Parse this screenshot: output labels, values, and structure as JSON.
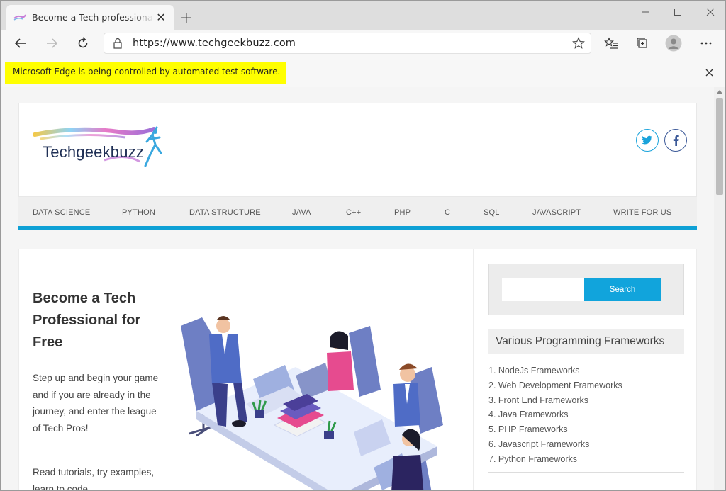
{
  "browser": {
    "tab_title": "Become a Tech professional for free",
    "url": "https://www.techgeekbuzz.com",
    "new_tab_symbol": "+",
    "tab_close_symbol": "✕"
  },
  "infobar": {
    "message": "Microsoft Edge is being controlled by automated test software."
  },
  "site": {
    "logo_text": "Techgeekbuzz",
    "nav": [
      "DATA SCIENCE",
      "PYTHON",
      "DATA STRUCTURE",
      "JAVA",
      "C++",
      "PHP",
      "C",
      "SQL",
      "JAVASCRIPT",
      "WRITE FOR US"
    ],
    "hero_title": "Become a Tech Professional for Free",
    "hero_text": "Step up and begin your game and if you are already in the journey, and enter the league of Tech Pros!",
    "hero_text2": "Read tutorials, try examples, learn to code.",
    "search_button": "Search",
    "search_value": "",
    "widget_title": "Various Programming Frameworks",
    "frameworks": [
      "1. NodeJs Frameworks",
      "2. Web Development Frameworks",
      "3. Front End Frameworks",
      "4. Java Frameworks",
      "5. PHP Frameworks",
      "6. Javascript Frameworks",
      "7. Python Frameworks"
    ]
  },
  "colors": {
    "accent": "#0ea0d5",
    "infobar_highlight": "#ffff00",
    "twitter": "#1aa3db",
    "facebook": "#3b5998"
  },
  "icons": {
    "back": "back-arrow-icon",
    "forward": "forward-arrow-icon",
    "refresh": "refresh-icon",
    "lock": "lock-icon",
    "favorite": "star-icon",
    "favorites_list": "favorites-icon",
    "collections": "collections-icon",
    "profile": "profile-icon",
    "menu": "more-icon",
    "twitter": "twitter-icon",
    "facebook": "facebook-icon"
  }
}
